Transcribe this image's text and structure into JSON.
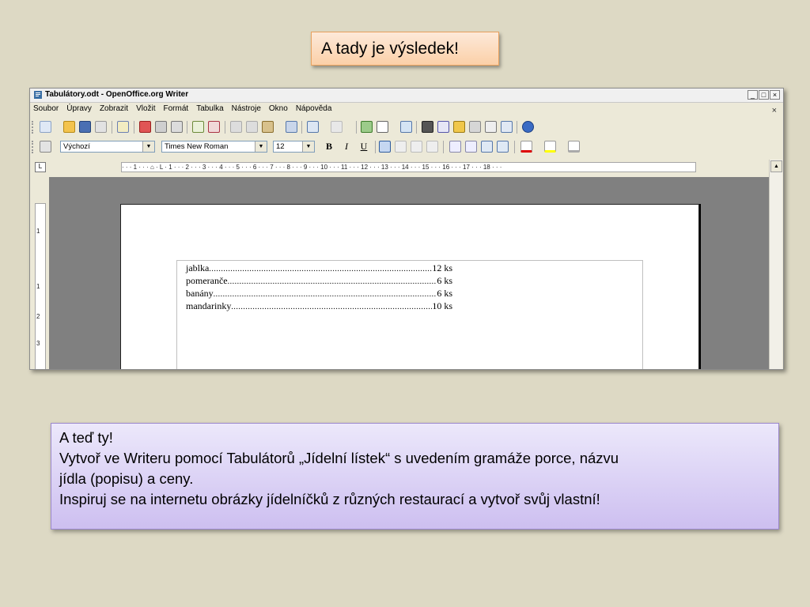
{
  "slide": {
    "top_callout": "A tady je výsledek!",
    "bottom_callout": {
      "line1": "A teď ty!",
      "line2": "Vytvoř ve Writeru pomocí Tabulátorů „Jídelní lístek“ s uvedením gramáže porce, názvu",
      "line3": "jídla (popisu) a ceny.",
      "line4": "Inspiruj se na internetu obrázky jídelníčků z různých restaurací a vytvoř svůj vlastní!"
    }
  },
  "window": {
    "title": "Tabulátory.odt - OpenOffice.org Writer",
    "controls": {
      "minimize": "_",
      "maximize": "□",
      "close": "×"
    },
    "doc_close": "×",
    "menu": [
      "Soubor",
      "Úpravy",
      "Zobrazit",
      "Vložit",
      "Formát",
      "Tabulka",
      "Nástroje",
      "Okno",
      "Nápověda"
    ],
    "formatting": {
      "style": "Výchozí",
      "font": "Times New Roman",
      "size": "12",
      "bold": "B",
      "italic": "I",
      "underline": "U"
    },
    "ruler_tab_selector": "L",
    "hruler_text": "· · · 1 · · · ⌂ · L · 1 · · · 2 · · · 3 · · · 4 · · · 5 · · · 6 · · · 7 · · · 8 · · · 9 · · · 10 · · · 11 · · · 12 · · · 13 · · · 14 · · · 15 · · · 16 · · · 17 · · · 18 · · ·",
    "vruler_labels": [
      "1",
      "1",
      "2",
      "3"
    ]
  },
  "document": {
    "rows": [
      {
        "label": "jablka",
        "value": "12 ks"
      },
      {
        "label": "pomeranče",
        "value": "6 ks"
      },
      {
        "label": "banány",
        "value": "6 ks"
      },
      {
        "label": "mandarinky",
        "value": "10 ks"
      }
    ]
  },
  "colors": {
    "background": "#ddd9c4",
    "top_callout_fill": "#fbd0a8",
    "bottom_callout_fill": "#cdbff0"
  }
}
